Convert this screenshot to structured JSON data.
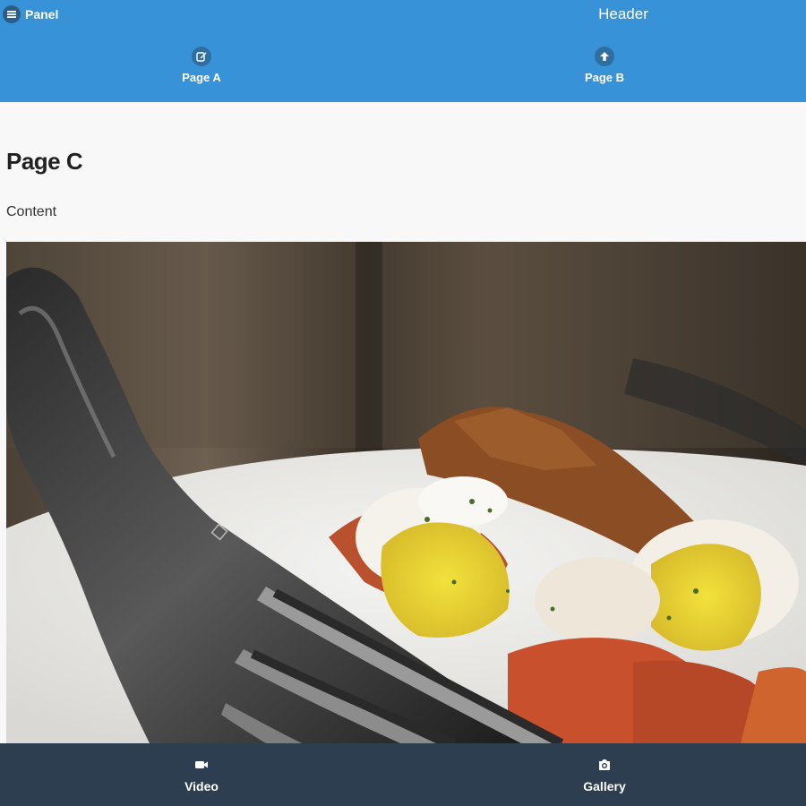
{
  "header": {
    "panel_label": "Panel",
    "title": "Header",
    "tabs": [
      {
        "label": "Page A",
        "icon": "edit-icon"
      },
      {
        "label": "Page B",
        "icon": "arrow-up-icon"
      }
    ]
  },
  "main": {
    "title": "Page C",
    "text": "Content",
    "image_icon": "food-photo"
  },
  "footer": {
    "tabs": [
      {
        "label": "Video",
        "icon": "video-camera-icon"
      },
      {
        "label": "Gallery",
        "icon": "camera-icon"
      }
    ]
  },
  "colors": {
    "header_bg": "#3892d8",
    "footer_bg": "#2c3e50",
    "page_bg": "#f8f8f8"
  }
}
